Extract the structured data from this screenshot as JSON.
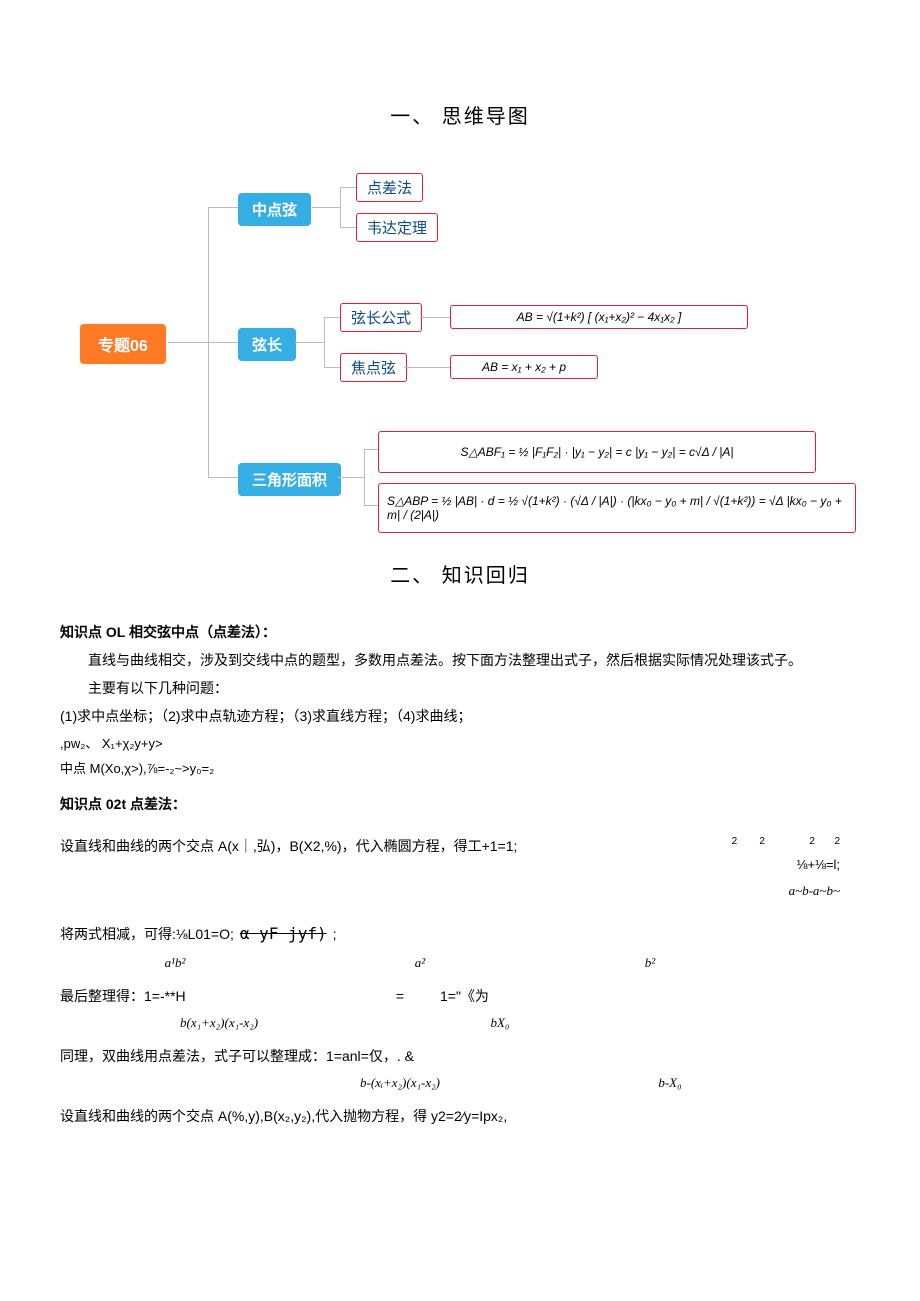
{
  "sections": {
    "title1": "一、 思维导图",
    "title2": "二、 知识回归"
  },
  "mindmap": {
    "root": "专题06",
    "branch1": {
      "label": "中点弦",
      "leaves": [
        "点差法",
        "韦达定理"
      ]
    },
    "branch2": {
      "label": "弦长",
      "leaves": [
        "弦长公式",
        "焦点弦"
      ],
      "formulas": [
        "AB = √(1+k²) [ (x₁+x₂)² − 4x₁x₂ ]",
        "AB = x₁ + x₂ + p"
      ]
    },
    "branch3": {
      "label": "三角形面积",
      "formulas": [
        "S△ABF₁ = ½ |F₁F₂| · |y₁ − y₂| = c |y₁ − y₂| = c√Δ / |A|",
        "S△ABP = ½ |AB| · d = ½ √(1+k²) · (√Δ / |A|) · (|kx₀ − y₀ + m| / √(1+k²)) = √Δ |kx₀ − y₀ + m| / (2|A|)"
      ]
    }
  },
  "k01": {
    "heading": "知识点 OL 相交弦中点（点差法）：",
    "p1": "直线与曲线相交，涉及到交线中点的题型，多数用点差法。按下面方法整理出式子，然后根据实际情况处理该式子。",
    "p2": "主要有以下几种问题：",
    "p3": "(1)求中点坐标；（2)求中点轨迹方程；（3)求直线方程；（4)求曲线；",
    "f1": ",pw₂、 X₁+χ₂y+y>",
    "f2": "中点 M(Xo,χ>),⅞=-₂~>y₀=₂"
  },
  "k02": {
    "heading": "知识点 02t 点差法：",
    "line1_a": "设直线和曲线的两个交点 A(x｜,弘)，B(X2,%)，代入椭圆方程，得工+1=1;",
    "line1_b_top": "2        2                2       2",
    "line1_b_bot": "⅛+⅛=l;",
    "line1_c": "a~b-a~b~",
    "line2_a": "将两式相减，可得:⅛L01=O;",
    "line2_strike": "α yF jyf)",
    "line2_b": ";",
    "line2_c1": "a¹b²",
    "line2_c2": "a²",
    "line2_c3": "b²",
    "line3_a": "最后整理得：1=-**H",
    "line3_b": "=",
    "line3_c": "1=\"《为",
    "line3_d1": "b(x₁+x₂)(x₁-x₂)",
    "line3_d2": "bX₀",
    "line4_a": "同理，双曲线用点差法，式子可以整理成：1=anl=仅，. &",
    "line4_d1": "b-(xᵢ+x₂)(x₁-x₂)",
    "line4_d2": "b-X₀",
    "line5": "设直线和曲线的两个交点 A(%,y),B(x₂,y₂),代入抛物方程，得 y2=2⁄y=Ipx₂,"
  }
}
